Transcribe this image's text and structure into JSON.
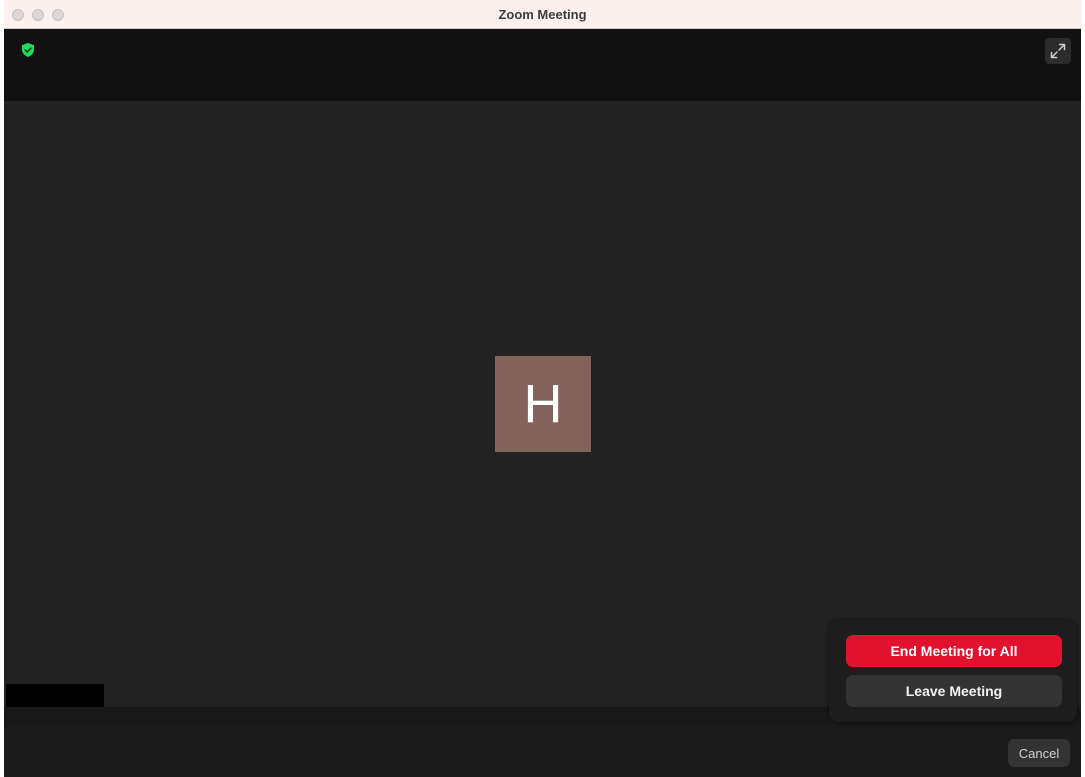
{
  "window": {
    "title": "Zoom Meeting"
  },
  "topbar": {
    "security_icon": "shield-check-icon",
    "fullscreen_icon": "expand-arrows-icon"
  },
  "participant": {
    "initial": "H",
    "avatar_color": "#82625a"
  },
  "end_menu": {
    "end_for_all_label": "End Meeting for All",
    "leave_label": "Leave Meeting"
  },
  "footer": {
    "cancel_label": "Cancel"
  },
  "colors": {
    "end_button": "#e0122d",
    "security_green": "#23d959",
    "titlebar": "#fdf1f0",
    "stage": "#222222"
  }
}
